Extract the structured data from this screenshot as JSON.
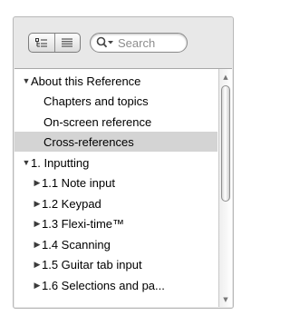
{
  "toolbar": {
    "view_buttons": [
      {
        "icon": "outline-view-icon"
      },
      {
        "icon": "list-view-icon"
      }
    ],
    "search": {
      "placeholder": "Search",
      "value": "",
      "icon": "search-dropdown-icon"
    }
  },
  "tree": {
    "rows": [
      {
        "label": "About this Reference",
        "state": "expanded",
        "selected": false
      },
      {
        "label": "Chapters and topics",
        "state": "leaf",
        "selected": false
      },
      {
        "label": "On-screen reference",
        "state": "leaf",
        "selected": false
      },
      {
        "label": "Cross-references",
        "state": "leaf",
        "selected": true
      },
      {
        "label": "1. Inputting",
        "state": "expanded",
        "selected": false
      },
      {
        "label": "1.1 Note input",
        "state": "collapsed",
        "selected": false
      },
      {
        "label": "1.2 Keypad",
        "state": "collapsed",
        "selected": false
      },
      {
        "label": "1.3 Flexi-time™",
        "state": "collapsed",
        "selected": false
      },
      {
        "label": "1.4 Scanning",
        "state": "collapsed",
        "selected": false
      },
      {
        "label": "1.5 Guitar tab input",
        "state": "collapsed",
        "selected": false
      },
      {
        "label": "1.6 Selections and pa...",
        "state": "collapsed",
        "selected": false
      }
    ]
  },
  "colors": {
    "selection": "#d4d4d4",
    "panel": "#e8e8e8"
  }
}
